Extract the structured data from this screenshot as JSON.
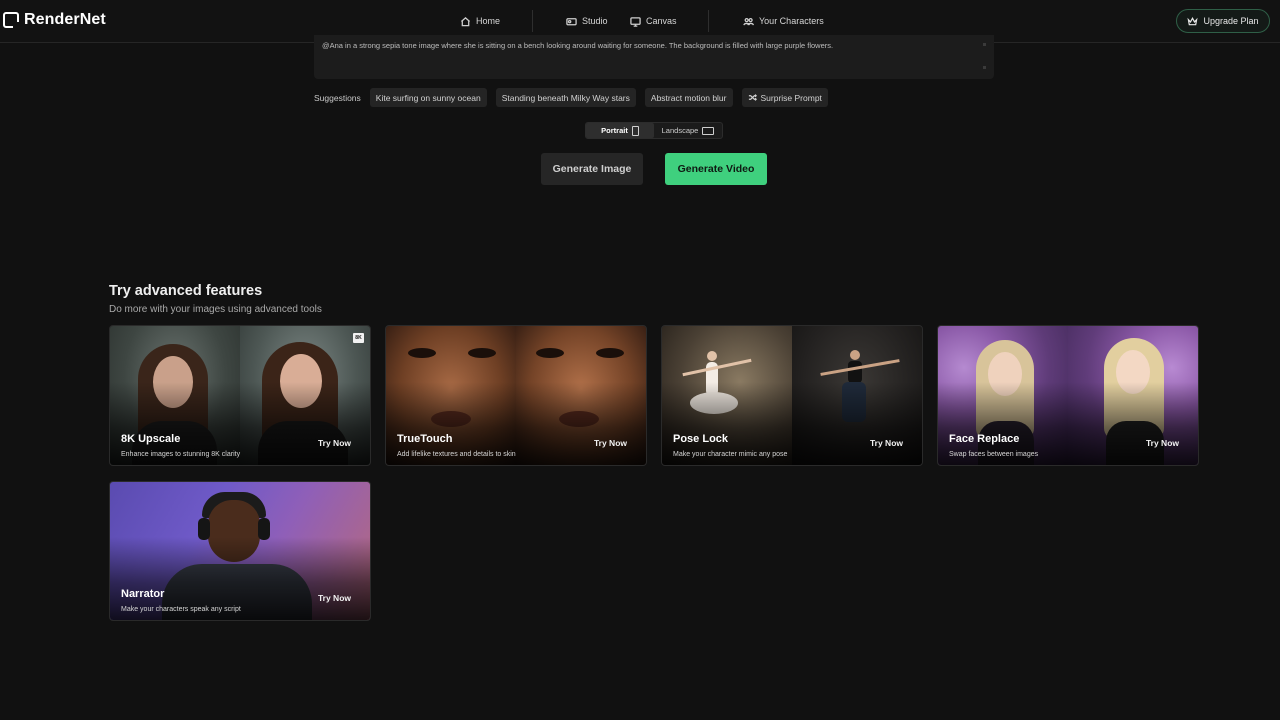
{
  "brand": {
    "name": "RenderNet"
  },
  "nav": {
    "home": "Home",
    "studio": "Studio",
    "canvas": "Canvas",
    "characters": "Your Characters",
    "upgrade": "Upgrade Plan"
  },
  "prompt": {
    "text": "@Ana  in a strong sepia tone image where she is sitting on a bench looking around waiting for someone. The background is filled with large purple flowers."
  },
  "suggestions": {
    "label": "Suggestions",
    "items": [
      "Kite surfing on sunny ocean",
      "Standing beneath Milky Way stars",
      "Abstract motion blur"
    ],
    "surprise": "Surprise Prompt"
  },
  "orientation": {
    "portrait": "Portrait",
    "landscape": "Landscape",
    "selected": "Portrait"
  },
  "actions": {
    "generate_image": "Generate Image",
    "generate_video": "Generate Video"
  },
  "features": {
    "title": "Try advanced features",
    "subtitle": "Do more with your images using advanced tools",
    "try_label": "Try Now",
    "badge_8k": "8K",
    "cards": [
      {
        "title": "8K Upscale",
        "desc": "Enhance images to stunning 8K clarity"
      },
      {
        "title": "TrueTouch",
        "desc": "Add lifelike textures and details to skin"
      },
      {
        "title": "Pose Lock",
        "desc": "Make your character mimic any pose"
      },
      {
        "title": "Face Replace",
        "desc": "Swap faces between images"
      },
      {
        "title": "Narrator",
        "desc": "Make your characters speak any script"
      }
    ]
  },
  "colors": {
    "background": "#111111",
    "accent_green": "#3fd07e"
  }
}
